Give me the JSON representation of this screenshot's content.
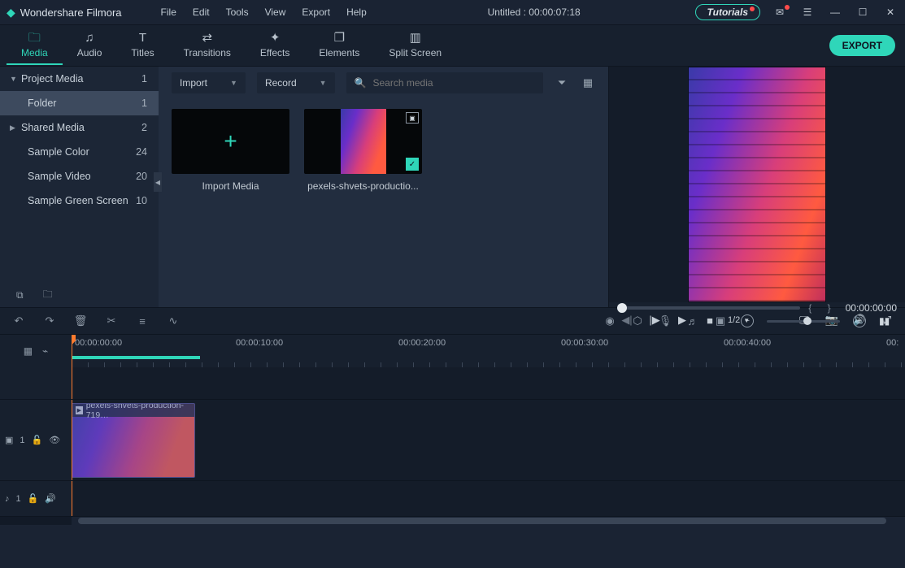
{
  "app": {
    "name": "Wondershare Filmora"
  },
  "menus": [
    "File",
    "Edit",
    "Tools",
    "View",
    "Export",
    "Help"
  ],
  "title": "Untitled : 00:00:07:18",
  "tutorials": "Tutorials",
  "ribbon": [
    {
      "key": "media",
      "label": "Media",
      "icon": "folder"
    },
    {
      "key": "audio",
      "label": "Audio",
      "icon": "music"
    },
    {
      "key": "titles",
      "label": "Titles",
      "icon": "letter"
    },
    {
      "key": "transitions",
      "label": "Transitions",
      "icon": "swap"
    },
    {
      "key": "effects",
      "label": "Effects",
      "icon": "sparkle"
    },
    {
      "key": "elements",
      "label": "Elements",
      "icon": "layers"
    },
    {
      "key": "split",
      "label": "Split Screen",
      "icon": "split"
    }
  ],
  "ribbon_active": "media",
  "export_label": "EXPORT",
  "sidebar": {
    "items": [
      {
        "label": "Project Media",
        "count": 1,
        "expandable": true,
        "open": true
      },
      {
        "label": "Folder",
        "count": 1,
        "sub": true,
        "selected": true
      },
      {
        "label": "Shared Media",
        "count": 2,
        "expandable": true
      },
      {
        "label": "Sample Color",
        "count": 24
      },
      {
        "label": "Sample Video",
        "count": 20
      },
      {
        "label": "Sample Green Screen",
        "count": 10
      }
    ]
  },
  "media_toolbar": {
    "import": "Import",
    "record": "Record",
    "search_placeholder": "Search media"
  },
  "media_cards": [
    {
      "kind": "import",
      "label": "Import Media"
    },
    {
      "kind": "clip",
      "label": "pexels-shvets-productio..."
    }
  ],
  "preview": {
    "time": "00:00:00:00",
    "zoom": "1/2"
  },
  "ruler": {
    "labels": [
      "00:00:00:00",
      "00:00:10:00",
      "00:00:20:00",
      "00:00:30:00",
      "00:00:40:00",
      "00:"
    ]
  },
  "clip_name": "pexels-shvets-production-719…",
  "tracks": {
    "video_label": "1",
    "audio_label": "1"
  }
}
